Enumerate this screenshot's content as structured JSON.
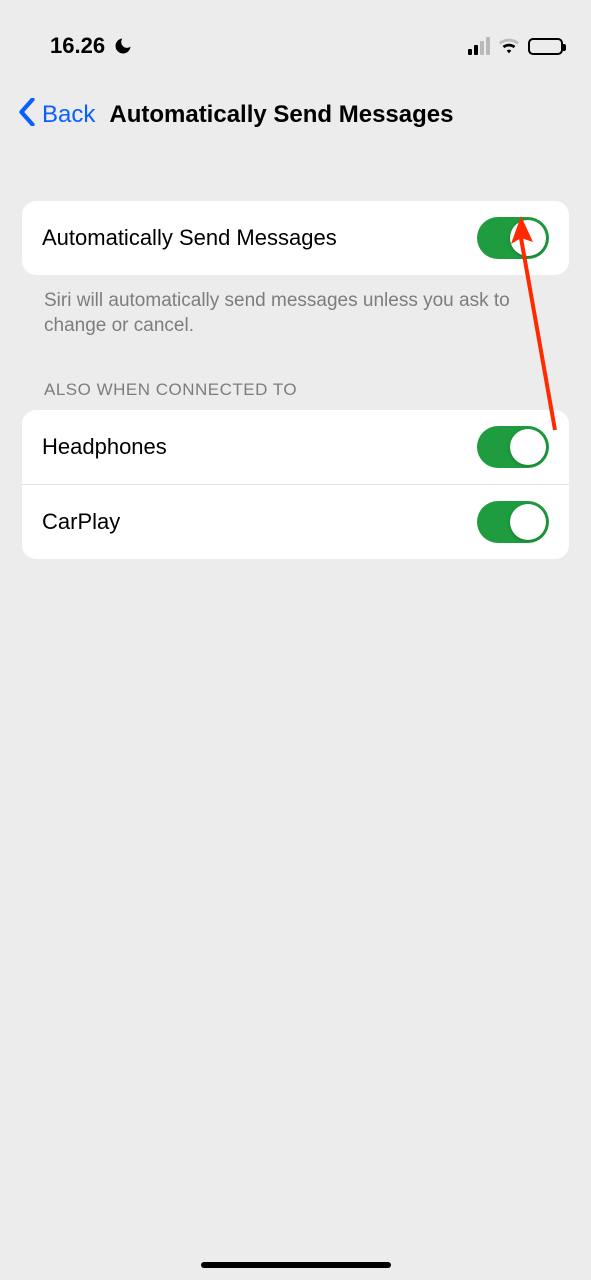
{
  "status": {
    "time": "16.26"
  },
  "nav": {
    "back": "Back",
    "title": "Automatically Send Messages"
  },
  "main_group": {
    "row1": {
      "label": "Automatically Send Messages",
      "on": true
    },
    "footer": "Siri will automatically send messages unless you ask to change or cancel."
  },
  "section2": {
    "header": "ALSO WHEN CONNECTED TO",
    "rows": [
      {
        "label": "Headphones",
        "on": true
      },
      {
        "label": "CarPlay",
        "on": true
      }
    ]
  }
}
